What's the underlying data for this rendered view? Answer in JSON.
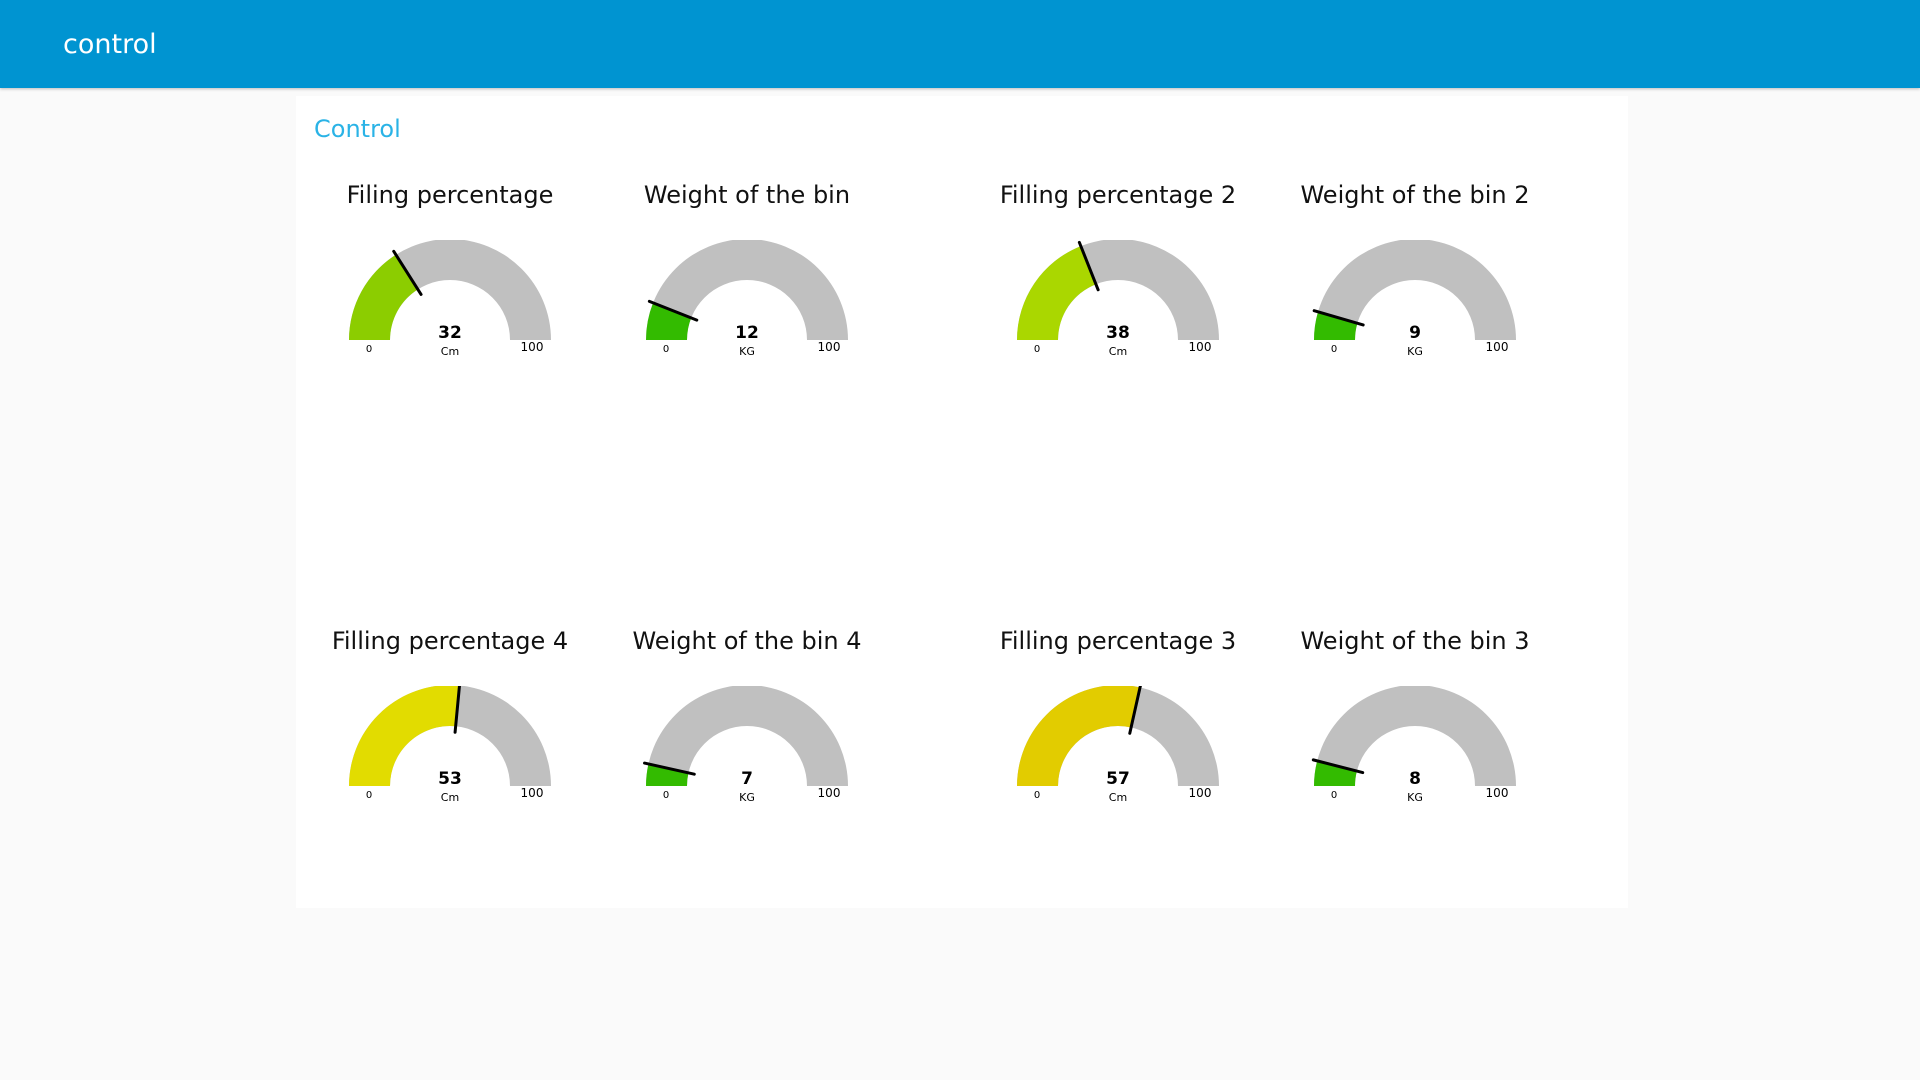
{
  "header": {
    "title": "control"
  },
  "panel": {
    "title": "Control"
  },
  "colors": {
    "header_bg": "#0094d1",
    "panel_title": "#2ab3e6",
    "gauge_track": "#c0c0c0",
    "needle": "#000000"
  },
  "gauges": [
    {
      "title": "Filing percentage",
      "value": 32,
      "unit": "Cm",
      "min": "0",
      "max": "100",
      "fill_color": "#8ccd00"
    },
    {
      "title": "Weight of the bin",
      "value": 12,
      "unit": "KG",
      "min": "0",
      "max": "100",
      "fill_color": "#33bb00"
    },
    {
      "title": "Filling percentage 2",
      "value": 38,
      "unit": "Cm",
      "min": "0",
      "max": "100",
      "fill_color": "#aad700"
    },
    {
      "title": "Weight of the bin 2",
      "value": 9,
      "unit": "KG",
      "min": "0",
      "max": "100",
      "fill_color": "#33bb00"
    },
    {
      "title": "Filling percentage 4",
      "value": 53,
      "unit": "Cm",
      "min": "0",
      "max": "100",
      "fill_color": "#e2dc00"
    },
    {
      "title": "Weight of the bin 4",
      "value": 7,
      "unit": "KG",
      "min": "0",
      "max": "100",
      "fill_color": "#33bb00"
    },
    {
      "title": "Filling percentage 3",
      "value": 57,
      "unit": "Cm",
      "min": "0",
      "max": "100",
      "fill_color": "#e2cc00"
    },
    {
      "title": "Weight of the bin 3",
      "value": 8,
      "unit": "KG",
      "min": "0",
      "max": "100",
      "fill_color": "#33bb00"
    }
  ]
}
